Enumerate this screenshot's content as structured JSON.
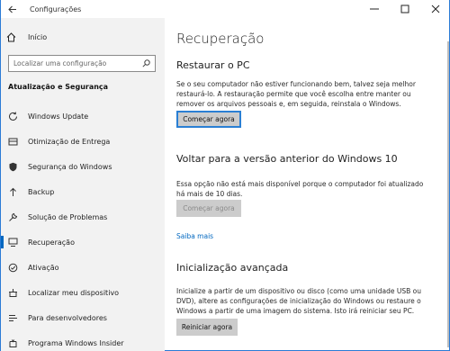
{
  "window": {
    "title": "Configurações",
    "back_icon": "back-arrow-icon",
    "minimize_glyph": "—",
    "maximize_glyph": "☐",
    "close_glyph": "✕"
  },
  "sidebar": {
    "home_label": "Início",
    "search_placeholder": "Localizar uma configuração",
    "section_title": "Atualização e Segurança",
    "items": [
      {
        "label": "Windows Update",
        "icon": "refresh-icon"
      },
      {
        "label": "Otimização de Entrega",
        "icon": "delivery-icon"
      },
      {
        "label": "Segurança do Windows",
        "icon": "shield-icon"
      },
      {
        "label": "Backup",
        "icon": "backup-arrow-icon"
      },
      {
        "label": "Solução de Problemas",
        "icon": "wrench-icon"
      },
      {
        "label": "Recuperação",
        "icon": "recovery-icon",
        "active": true
      },
      {
        "label": "Ativação",
        "icon": "activation-check-icon"
      },
      {
        "label": "Localizar meu dispositivo",
        "icon": "find-device-icon"
      },
      {
        "label": "Para desenvolvedores",
        "icon": "developer-icon"
      },
      {
        "label": "Programa Windows Insider",
        "icon": "insider-icon"
      }
    ]
  },
  "main": {
    "page_title": "Recuperação",
    "reset": {
      "heading": "Restaurar o PC",
      "description": "Se o seu computador não estiver funcionando bem, talvez seja melhor restaurá-lo. A restauração permite que você escolha entre manter ou remover os arquivos pessoais e, em seguida, reinstala o Windows.",
      "button": "Começar agora"
    },
    "go_back": {
      "heading": "Voltar para a versão anterior do Windows 10",
      "description": "Essa opção não está mais disponível porque o computador foi atualizado há mais de 10 dias.",
      "button": "Começar agora",
      "link": "Saiba mais"
    },
    "advanced": {
      "heading": "Inicialização avançada",
      "description": "Inicialize a partir de um dispositivo ou disco (como uma unidade USB ou DVD), altere as configurações de inicialização do Windows ou restaure o Windows a partir de uma imagem do sistema. Isto irá reiniciar seu PC.",
      "button": "Reiniciar agora"
    }
  }
}
